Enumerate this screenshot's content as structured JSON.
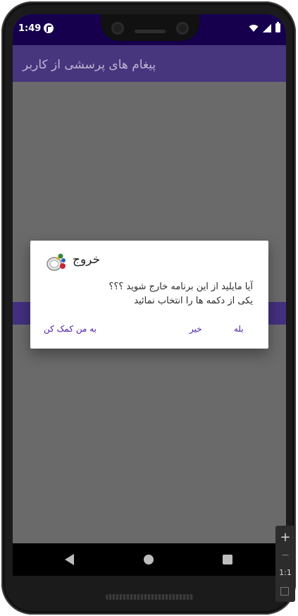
{
  "status_bar": {
    "time": "1:49"
  },
  "app_bar": {
    "title": "پیغام های پرسشی از کاربر"
  },
  "dialog": {
    "title": "خروج",
    "message_lines": [
      "آیا مایلید از این برنامه خارج شوید ؟؟؟",
      "یکی از دکمه ها را انتخاب نمائید"
    ],
    "buttons": {
      "help": "به من کمک کن",
      "no": "خیر",
      "yes": "بله"
    }
  },
  "zoom_controls": {
    "plus": "+",
    "minus": "−",
    "ratio": "1:1"
  },
  "colors": {
    "status_bar": "#16004e",
    "app_bar": "#2a0a8e",
    "accent": "#4b1aa8",
    "scrim": "#6a6a6a"
  },
  "icons": [
    "app-status-icon",
    "wifi-icon",
    "signal-icon",
    "battery-icon",
    "dialog-app-icon",
    "back-icon",
    "home-icon",
    "recents-icon"
  ]
}
